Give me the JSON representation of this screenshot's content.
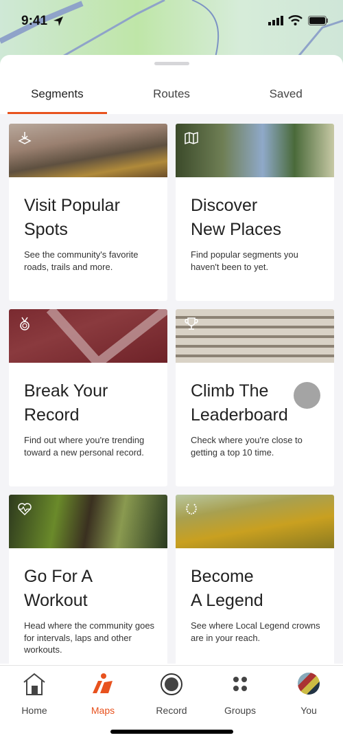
{
  "status_bar": {
    "time": "9:41",
    "icons": [
      "location-arrow-icon",
      "signal-icon",
      "wifi-icon",
      "battery-icon"
    ]
  },
  "tabs": [
    {
      "label": "Segments",
      "active": true
    },
    {
      "label": "Routes",
      "active": false
    },
    {
      "label": "Saved",
      "active": false
    }
  ],
  "accent": "#e8521e",
  "cards": [
    {
      "icon": "pin-icon",
      "title1": "Visit Popular",
      "title2": "Spots",
      "desc": "See the community's favorite roads, trails and more."
    },
    {
      "icon": "map-icon",
      "title1": "Discover",
      "title2": "New Places",
      "desc": "Find popular segments you haven't been to yet."
    },
    {
      "icon": "medal-icon",
      "title1": "Break Your",
      "title2": "Record",
      "desc": "Find out where you're trending toward a new personal record."
    },
    {
      "icon": "trophy-icon",
      "title1": "Climb The",
      "title2": "Leaderboard",
      "desc": "Check where you're close to getting a top 10 time."
    },
    {
      "icon": "heart-pulse-icon",
      "title1": "Go For A",
      "title2": "Workout",
      "desc": "Head where the community goes for intervals, laps and other workouts."
    },
    {
      "icon": "laurel-icon",
      "title1": "Become",
      "title2": "A Legend",
      "desc": "See where Local Legend crowns are in your reach."
    }
  ],
  "nav": [
    {
      "label": "Home",
      "icon": "home-icon"
    },
    {
      "label": "Maps",
      "icon": "maps-icon",
      "active": true
    },
    {
      "label": "Record",
      "icon": "record-icon"
    },
    {
      "label": "Groups",
      "icon": "groups-icon"
    },
    {
      "label": "You",
      "icon": "avatar"
    }
  ]
}
